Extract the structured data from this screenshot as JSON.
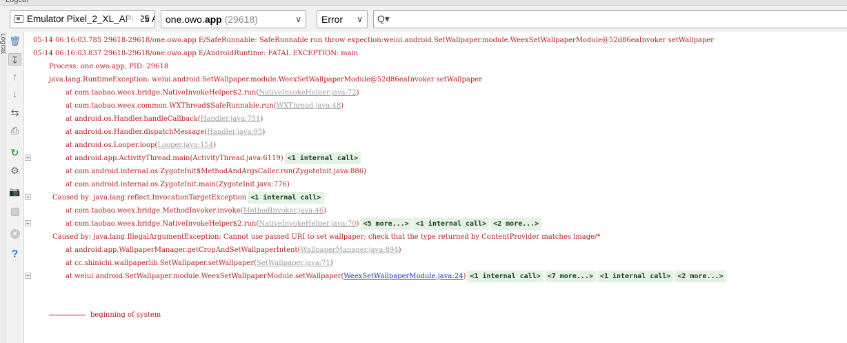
{
  "window": {
    "title": "Logcat"
  },
  "toolbar": {
    "device": "Emulator Pixel_2_XL_API_25 A",
    "process_pkg_start": "one.owo.",
    "process_pkg_bold": "app",
    "process_pid": " (29618)",
    "level": "Error",
    "search_value": "",
    "search_icon_glyph": "Q▾"
  },
  "sidebar": {
    "icons": [
      "trash-icon",
      "scroll-to-end-icon",
      "up-icon",
      "down-icon",
      "soft-wrap-icon",
      "print-icon",
      "restart-icon",
      "settings-icon",
      "screenshot-icon",
      "screen-record-icon",
      "close-icon",
      "help-icon"
    ]
  },
  "log": {
    "l1": "05-14 06:16:03.785 29618-29618/one.owo.app E/SafeRunnable: SafeRunnable run throw expection:weiui.android.SetWallpaper.module.WeexSetWallpaperModule@52d86eaInvoker setWallpaper",
    "l2": "05-14 06:16:03.837 29618-29618/one.owo.app E/AndroidRuntime: FATAL EXCEPTION: main",
    "l3": "Process: one.owo.app, PID: 29618",
    "l4": "java.lang.RuntimeException: weiui.android.SetWallpaper.module.WeexSetWallpaperModule@52d86eaInvoker setWallpaper",
    "l5_pre": "at com.taobao.weex.bridge.NativeInvokeHelper$2.run(",
    "l5_link": "NativeInvokeHelper.java:72",
    "l6_pre": "at com.taobao.weex.common.WXThread$SafeRunnable.run(",
    "l6_link": "WXThread.java:48",
    "l7_pre": "at android.os.Handler.handleCallback(",
    "l7_link": "Handler.java:751",
    "l8_pre": "at android.os.Handler.dispatchMessage(",
    "l8_link": "Handler.java:95",
    "l9_pre": "at android.os.Looper.loop(",
    "l9_link": "Looper.java:154",
    "l10": "at android.app.ActivityThread.main(ActivityThread.java:6119)",
    "l10_chip": "<1 internal call>",
    "l11": "at com.android.internal.os.ZygoteInit$MethodAndArgsCaller.run(ZygoteInit.java:886)",
    "l12": "at com.android.internal.os.ZygoteInit.main(ZygoteInit.java:776)",
    "l13": "Caused by: java.lang.reflect.InvocationTargetException",
    "l13_chip": "<1 internal call>",
    "l14_pre": "at com.taobao.weex.bridge.MethodInvoker.invoke(",
    "l14_link": "MethodInvoker.java:46",
    "l15_pre": "at com.taobao.weex.bridge.NativeInvokeHelper$2.run(",
    "l15_link": "NativeInvokeHelper.java:70",
    "l15_chip1": "<5 more...>",
    "l15_chip2": "<1 internal call>",
    "l15_chip3": "<2 more...>",
    "l16": "Caused by: java.lang.IllegalArgumentException: Cannot use passed URI to set wallpaper; check that the type returned by ContentProvider matches image/*",
    "l17_pre": "at android.app.WallpaperManager.getCropAndSetWallpaperIntent(",
    "l17_link": "WallpaperManager.java:894",
    "l18_pre": "at cc.shinichi.wallpaperlib.SetWallpaper.setWallpaper(",
    "l18_link": "SetWallpaper.java:71",
    "l19_pre": "at weiui.android.SetWallpaper.module.WeexSetWallpaperModule.setWallpaper(",
    "l19_link": "WeexSetWallpaperModule.java:24",
    "l19_chip1": "<1 internal call>",
    "l19_chip2": "<7 more...>",
    "l19_chip3": "<1 internal call>",
    "l19_chip4": "<2 more...>",
    "close_paren": ")",
    "beginning": "beginning of system"
  }
}
